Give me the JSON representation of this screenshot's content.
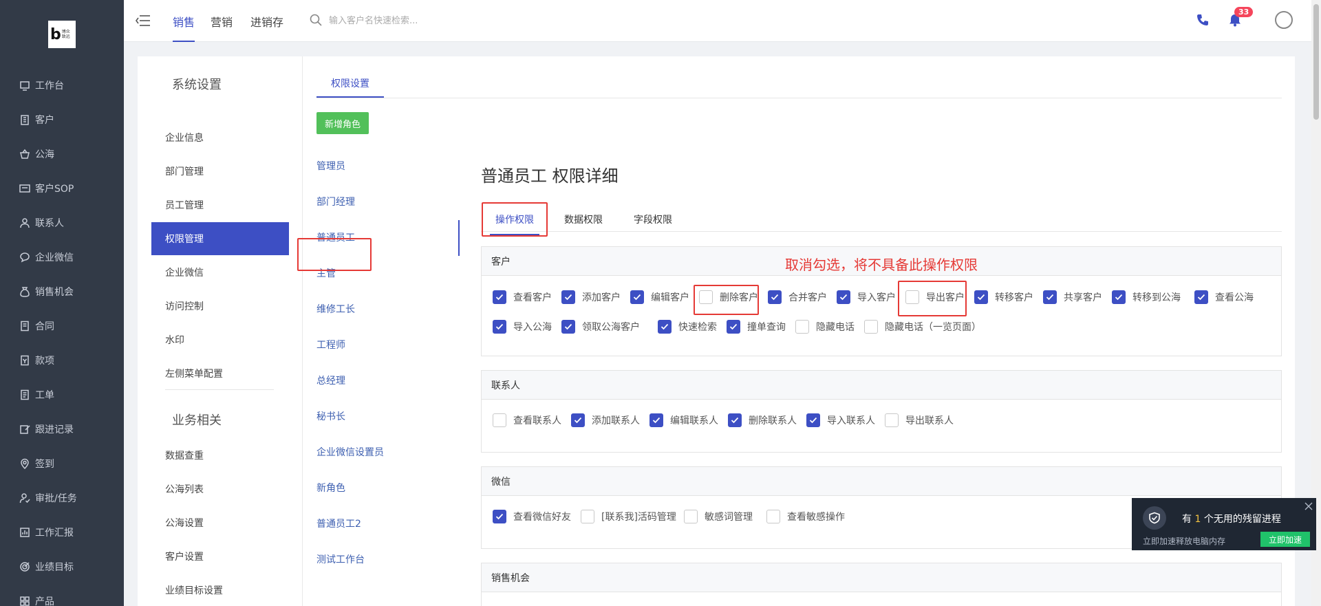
{
  "logo": {
    "mark": "b",
    "text_line1": "博众",
    "text_line2": "致远"
  },
  "nav": {
    "items": [
      {
        "label": "工作台",
        "icon": "monitor-icon"
      },
      {
        "label": "客户",
        "icon": "building-icon"
      },
      {
        "label": "公海",
        "icon": "basket-icon"
      },
      {
        "label": "客户SOP",
        "icon": "sop-icon"
      },
      {
        "label": "联系人",
        "icon": "user-icon"
      },
      {
        "label": "企业微信",
        "icon": "chat-icon"
      },
      {
        "label": "销售机会",
        "icon": "moneybag-icon"
      },
      {
        "label": "合同",
        "icon": "contract-icon"
      },
      {
        "label": "款项",
        "icon": "payment-icon"
      },
      {
        "label": "工单",
        "icon": "ticket-icon"
      },
      {
        "label": "跟进记录",
        "icon": "edit-icon"
      },
      {
        "label": "签到",
        "icon": "location-icon"
      },
      {
        "label": "审批/任务",
        "icon": "approval-icon"
      },
      {
        "label": "工作汇报",
        "icon": "report-icon"
      },
      {
        "label": "业绩目标",
        "icon": "target-icon"
      },
      {
        "label": "产品",
        "icon": "grid-icon"
      }
    ]
  },
  "header": {
    "tabs": [
      {
        "label": "销售",
        "active": true
      },
      {
        "label": "营销",
        "active": false
      },
      {
        "label": "进销存",
        "active": false
      }
    ],
    "search_placeholder": "输入客户名快速检索...",
    "notification_count": "33",
    "accent_color": "#3d4fc4"
  },
  "settings": {
    "system_title": "系统设置",
    "system_items": [
      {
        "label": "企业信息",
        "active": false
      },
      {
        "label": "部门管理",
        "active": false
      },
      {
        "label": "员工管理",
        "active": false
      },
      {
        "label": "权限管理",
        "active": true
      },
      {
        "label": "企业微信",
        "active": false
      },
      {
        "label": "访问控制",
        "active": false
      },
      {
        "label": "水印",
        "active": false
      },
      {
        "label": "左侧菜单配置",
        "active": false
      }
    ],
    "business_title": "业务相关",
    "business_items": [
      {
        "label": "数据查重"
      },
      {
        "label": "公海列表"
      },
      {
        "label": "公海设置"
      },
      {
        "label": "客户设置"
      },
      {
        "label": "业绩目标设置"
      }
    ]
  },
  "permissions": {
    "tab_label": "权限设置",
    "new_role_label": "新增角色",
    "roles": [
      "管理员",
      "部门经理",
      "普通员工",
      "主管",
      "维修工长",
      "工程师",
      "总经理",
      "秘书长",
      "企业微信设置员",
      "新角色",
      "普通员工2",
      "测试工作台"
    ],
    "selected_role": "普通员工",
    "detail_title": "普通员工 权限详细",
    "sub_tabs": [
      {
        "label": "操作权限",
        "active": true
      },
      {
        "label": "数据权限",
        "active": false
      },
      {
        "label": "字段权限",
        "active": false
      }
    ],
    "annotation": "取消勾选，将不具备此操作权限",
    "groups": [
      {
        "title": "客户",
        "rows": [
          [
            {
              "label": "查看客户",
              "checked": true
            },
            {
              "label": "添加客户",
              "checked": true
            },
            {
              "label": "编辑客户",
              "checked": true
            },
            {
              "label": "删除客户",
              "checked": false
            },
            {
              "label": "合并客户",
              "checked": true
            },
            {
              "label": "导入客户",
              "checked": true
            },
            {
              "label": "导出客户",
              "checked": false
            },
            {
              "label": "转移客户",
              "checked": true
            },
            {
              "label": "共享客户",
              "checked": true
            },
            {
              "label": "转移到公海",
              "checked": true
            },
            {
              "label": "查看公海",
              "checked": true
            }
          ],
          [
            {
              "label": "导入公海",
              "checked": true
            },
            {
              "label": "领取公海客户",
              "checked": true
            },
            {
              "label": "快速检索",
              "checked": true
            },
            {
              "label": "撞单查询",
              "checked": true
            },
            {
              "label": "隐藏电话",
              "checked": false
            },
            {
              "label": "隐藏电话（一览页面）",
              "checked": false
            }
          ]
        ]
      },
      {
        "title": "联系人",
        "rows": [
          [
            {
              "label": "查看联系人",
              "checked": false
            },
            {
              "label": "添加联系人",
              "checked": true
            },
            {
              "label": "编辑联系人",
              "checked": true
            },
            {
              "label": "删除联系人",
              "checked": true
            },
            {
              "label": "导入联系人",
              "checked": true
            },
            {
              "label": "导出联系人",
              "checked": false
            }
          ]
        ]
      },
      {
        "title": "微信",
        "rows": [
          [
            {
              "label": "查看微信好友",
              "checked": true
            },
            {
              "label": "[联系我]活码管理",
              "checked": false
            },
            {
              "label": "敏感词管理",
              "checked": false
            },
            {
              "label": "查看敏感操作",
              "checked": false
            }
          ]
        ]
      },
      {
        "title": "销售机会",
        "rows": []
      }
    ]
  },
  "toast": {
    "msg_prefix": "有",
    "msg_count": "1",
    "msg_suffix": "个无用的残留进程",
    "sub": "立即加速释放电脑内存",
    "button": "立即加速"
  }
}
